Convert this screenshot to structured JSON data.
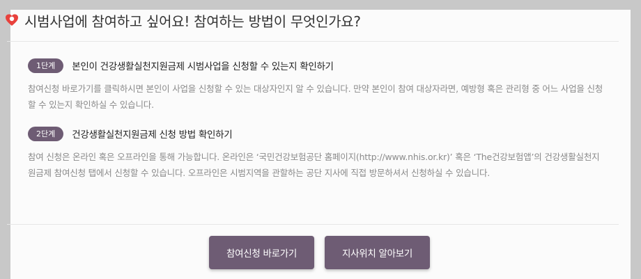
{
  "header": {
    "title": "시범사업에 참여하고 싶어요! 참여하는 방법이 무엇인가요?",
    "icon": "heart-icon"
  },
  "steps": [
    {
      "badge": "1단계",
      "title": "본인이 건강생활실천지원금제 시범사업을 신청할 수 있는지 확인하기",
      "description": "참여신청 바로가기를 클릭하시면 본인이 사업을 신청할 수 있는 대상자인지 알 수 있습니다. 만약 본인이 참여 대상자라면, 예방형 혹은 관리형 중 어느 사업을 신청할 수 있는지 확인하실 수 있습니다."
    },
    {
      "badge": "2단계",
      "title": "건강생활실천지원금제 신청 방법 확인하기",
      "description": "참여 신청은 온라인 혹은 오프라인을 통해 가능합니다. 온라인은 ‘국민건강보험공단 홈페이지(http://www.nhis.or.kr)’ 혹은 ‘The건강보험앱’의 건강생활실천지원금제 참여신청 탭에서 신청할 수 있습니다. 오프라인은 시범지역을 관할하는 공단 지사에 직접 방문하셔서 신청하실 수 있습니다."
    }
  ],
  "buttons": {
    "apply_label": "참여신청 바로가기",
    "branch_label": "지사위치 알아보기"
  },
  "colors": {
    "accent": "#6e5c74",
    "heart": "#e8413c"
  }
}
